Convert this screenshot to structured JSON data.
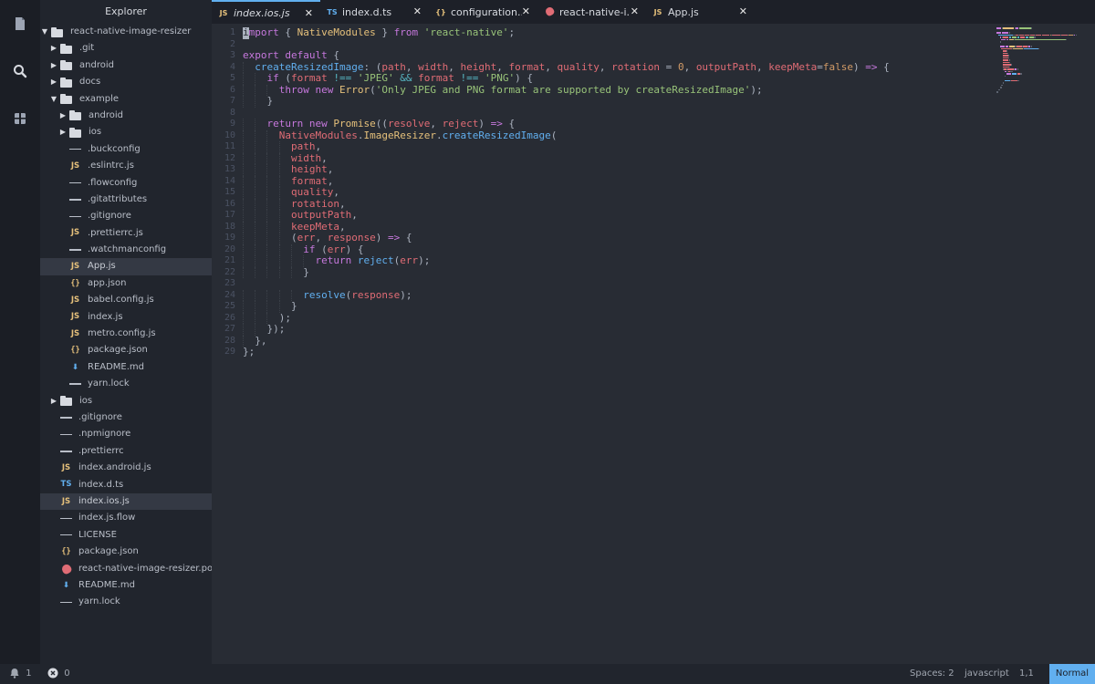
{
  "sidebar": {
    "title": "Explorer",
    "tree": [
      {
        "name": "react-native-image-resizer",
        "type": "folder",
        "open": true,
        "depth": 0
      },
      {
        "name": ".git",
        "type": "folder",
        "open": false,
        "depth": 1
      },
      {
        "name": "android",
        "type": "folder",
        "open": false,
        "depth": 1
      },
      {
        "name": "docs",
        "type": "folder",
        "open": false,
        "depth": 1
      },
      {
        "name": "example",
        "type": "folder",
        "open": true,
        "depth": 1
      },
      {
        "name": "android",
        "type": "folder",
        "open": false,
        "depth": 2
      },
      {
        "name": "ios",
        "type": "folder",
        "open": false,
        "depth": 2
      },
      {
        "name": ".buckconfig",
        "type": "cfg",
        "depth": 2
      },
      {
        "name": ".eslintrc.js",
        "type": "js",
        "depth": 2
      },
      {
        "name": ".flowconfig",
        "type": "cfg",
        "depth": 2
      },
      {
        "name": ".gitattributes",
        "type": "cfg",
        "depth": 2
      },
      {
        "name": ".gitignore",
        "type": "cfg",
        "depth": 2
      },
      {
        "name": ".prettierrc.js",
        "type": "js",
        "depth": 2
      },
      {
        "name": ".watchmanconfig",
        "type": "cfg",
        "depth": 2
      },
      {
        "name": "App.js",
        "type": "js",
        "depth": 2,
        "selected": true
      },
      {
        "name": "app.json",
        "type": "json",
        "depth": 2
      },
      {
        "name": "babel.config.js",
        "type": "js",
        "depth": 2
      },
      {
        "name": "index.js",
        "type": "js",
        "depth": 2
      },
      {
        "name": "metro.config.js",
        "type": "js",
        "depth": 2
      },
      {
        "name": "package.json",
        "type": "json",
        "depth": 2
      },
      {
        "name": "README.md",
        "type": "md",
        "depth": 2
      },
      {
        "name": "yarn.lock",
        "type": "cfg",
        "depth": 2
      },
      {
        "name": "ios",
        "type": "folder",
        "open": false,
        "depth": 1
      },
      {
        "name": ".gitignore",
        "type": "cfg",
        "depth": 1
      },
      {
        "name": ".npmignore",
        "type": "cfg",
        "depth": 1
      },
      {
        "name": ".prettierrc",
        "type": "cfg",
        "depth": 1
      },
      {
        "name": "index.android.js",
        "type": "js",
        "depth": 1
      },
      {
        "name": "index.d.ts",
        "type": "ts",
        "depth": 1
      },
      {
        "name": "index.ios.js",
        "type": "js",
        "depth": 1,
        "selected": true
      },
      {
        "name": "index.js.flow",
        "type": "cfg",
        "depth": 1
      },
      {
        "name": "LICENSE",
        "type": "cfg",
        "depth": 1
      },
      {
        "name": "package.json",
        "type": "json",
        "depth": 1
      },
      {
        "name": "react-native-image-resizer.podspec",
        "type": "pod",
        "depth": 1
      },
      {
        "name": "README.md",
        "type": "md",
        "depth": 1
      },
      {
        "name": "yarn.lock",
        "type": "cfg",
        "depth": 1
      }
    ]
  },
  "tabs": [
    {
      "label": "index.ios.js",
      "icon": "JS",
      "active": true,
      "italic": true
    },
    {
      "label": "index.d.ts",
      "icon": "TS",
      "active": false
    },
    {
      "label": "configuration....",
      "icon": "{}",
      "active": false
    },
    {
      "label": "react-native-i...",
      "icon": "pod",
      "active": false
    },
    {
      "label": "App.js",
      "icon": "JS",
      "active": false
    }
  ],
  "editor": {
    "lines": [
      [
        [
          "k",
          "import"
        ],
        [
          "p",
          " { "
        ],
        [
          "c",
          "NativeModules"
        ],
        [
          "p",
          " } "
        ],
        [
          "k",
          "from"
        ],
        [
          "p",
          " "
        ],
        [
          "s",
          "'react-native'"
        ],
        [
          "p",
          ";"
        ]
      ],
      [],
      [
        [
          "k",
          "export"
        ],
        [
          "p",
          " "
        ],
        [
          "k",
          "default"
        ],
        [
          "p",
          " {"
        ]
      ],
      [
        [
          "p",
          "  "
        ],
        [
          "f",
          "createResizedImage"
        ],
        [
          "p",
          ": ("
        ],
        [
          "v",
          "path"
        ],
        [
          "p",
          ", "
        ],
        [
          "v",
          "width"
        ],
        [
          "p",
          ", "
        ],
        [
          "v",
          "height"
        ],
        [
          "p",
          ", "
        ],
        [
          "v",
          "format"
        ],
        [
          "p",
          ", "
        ],
        [
          "v",
          "quality"
        ],
        [
          "p",
          ", "
        ],
        [
          "v",
          "rotation"
        ],
        [
          "p",
          " = "
        ],
        [
          "n",
          "0"
        ],
        [
          "p",
          ", "
        ],
        [
          "v",
          "outputPath"
        ],
        [
          "p",
          ", "
        ],
        [
          "v",
          "keepMeta"
        ],
        [
          "p",
          "="
        ],
        [
          "n",
          "false"
        ],
        [
          "p",
          ") "
        ],
        [
          "k",
          "=>"
        ],
        [
          "p",
          " {"
        ]
      ],
      [
        [
          "p",
          "    "
        ],
        [
          "k",
          "if"
        ],
        [
          "p",
          " ("
        ],
        [
          "v",
          "format"
        ],
        [
          "p",
          " "
        ],
        [
          "o",
          "!=="
        ],
        [
          "p",
          " "
        ],
        [
          "s",
          "'JPEG'"
        ],
        [
          "p",
          " "
        ],
        [
          "o",
          "&&"
        ],
        [
          "p",
          " "
        ],
        [
          "v",
          "format"
        ],
        [
          "p",
          " "
        ],
        [
          "o",
          "!=="
        ],
        [
          "p",
          " "
        ],
        [
          "s",
          "'PNG'"
        ],
        [
          "p",
          ") {"
        ]
      ],
      [
        [
          "p",
          "      "
        ],
        [
          "k",
          "throw"
        ],
        [
          "p",
          " "
        ],
        [
          "k",
          "new"
        ],
        [
          "p",
          " "
        ],
        [
          "c",
          "Error"
        ],
        [
          "p",
          "("
        ],
        [
          "s",
          "'Only JPEG and PNG format are supported by createResizedImage'"
        ],
        [
          "p",
          ");"
        ]
      ],
      [
        [
          "p",
          "    }"
        ]
      ],
      [],
      [
        [
          "p",
          "    "
        ],
        [
          "k",
          "return"
        ],
        [
          "p",
          " "
        ],
        [
          "k",
          "new"
        ],
        [
          "p",
          " "
        ],
        [
          "c",
          "Promise"
        ],
        [
          "p",
          "(("
        ],
        [
          "v",
          "resolve"
        ],
        [
          "p",
          ", "
        ],
        [
          "v",
          "reject"
        ],
        [
          "p",
          ") "
        ],
        [
          "k",
          "=>"
        ],
        [
          "p",
          " {"
        ]
      ],
      [
        [
          "p",
          "      "
        ],
        [
          "v",
          "NativeModules"
        ],
        [
          "p",
          "."
        ],
        [
          "c",
          "ImageResizer"
        ],
        [
          "p",
          "."
        ],
        [
          "f",
          "createResizedImage"
        ],
        [
          "p",
          "("
        ]
      ],
      [
        [
          "p",
          "        "
        ],
        [
          "v",
          "path"
        ],
        [
          "p",
          ","
        ]
      ],
      [
        [
          "p",
          "        "
        ],
        [
          "v",
          "width"
        ],
        [
          "p",
          ","
        ]
      ],
      [
        [
          "p",
          "        "
        ],
        [
          "v",
          "height"
        ],
        [
          "p",
          ","
        ]
      ],
      [
        [
          "p",
          "        "
        ],
        [
          "v",
          "format"
        ],
        [
          "p",
          ","
        ]
      ],
      [
        [
          "p",
          "        "
        ],
        [
          "v",
          "quality"
        ],
        [
          "p",
          ","
        ]
      ],
      [
        [
          "p",
          "        "
        ],
        [
          "v",
          "rotation"
        ],
        [
          "p",
          ","
        ]
      ],
      [
        [
          "p",
          "        "
        ],
        [
          "v",
          "outputPath"
        ],
        [
          "p",
          ","
        ]
      ],
      [
        [
          "p",
          "        "
        ],
        [
          "v",
          "keepMeta"
        ],
        [
          "p",
          ","
        ]
      ],
      [
        [
          "p",
          "        ("
        ],
        [
          "v",
          "err"
        ],
        [
          "p",
          ", "
        ],
        [
          "v",
          "response"
        ],
        [
          "p",
          ") "
        ],
        [
          "k",
          "=>"
        ],
        [
          "p",
          " {"
        ]
      ],
      [
        [
          "p",
          "          "
        ],
        [
          "k",
          "if"
        ],
        [
          "p",
          " ("
        ],
        [
          "v",
          "err"
        ],
        [
          "p",
          ") {"
        ]
      ],
      [
        [
          "p",
          "            "
        ],
        [
          "k",
          "return"
        ],
        [
          "p",
          " "
        ],
        [
          "f",
          "reject"
        ],
        [
          "p",
          "("
        ],
        [
          "v",
          "err"
        ],
        [
          "p",
          ");"
        ]
      ],
      [
        [
          "p",
          "          }"
        ]
      ],
      [],
      [
        [
          "p",
          "          "
        ],
        [
          "f",
          "resolve"
        ],
        [
          "p",
          "("
        ],
        [
          "v",
          "response"
        ],
        [
          "p",
          ");"
        ]
      ],
      [
        [
          "p",
          "        }"
        ]
      ],
      [
        [
          "p",
          "      );"
        ]
      ],
      [
        [
          "p",
          "    });"
        ]
      ],
      [
        [
          "p",
          "  },"
        ]
      ],
      [
        [
          "p",
          "};"
        ]
      ]
    ]
  },
  "statusbar": {
    "notifications": "1",
    "errors": "0",
    "spaces": "Spaces: 2",
    "language": "javascript",
    "position": "1,1",
    "mode": "Normal"
  },
  "icons": {
    "explorer": "file-icon",
    "search": "search-icon",
    "extensions": "package-icon",
    "bell": "bell-icon",
    "error": "error-circle-icon"
  }
}
